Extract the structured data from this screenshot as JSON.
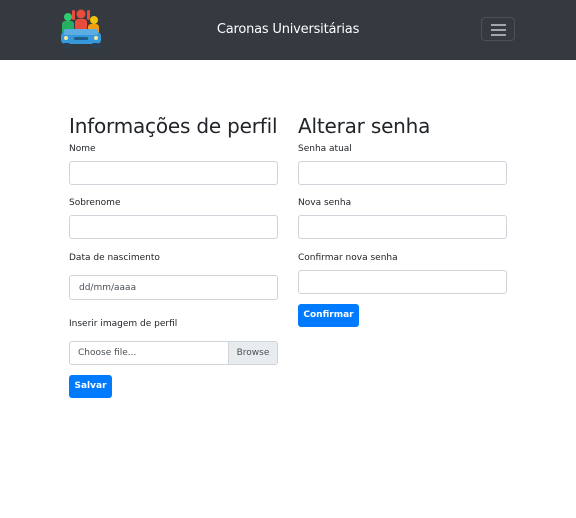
{
  "navbar": {
    "brand": "Caronas Universitárias",
    "logo_icon": "car-people-logo-icon",
    "menu_icon": "hamburger-menu-icon",
    "background": "#343a40"
  },
  "profile": {
    "heading": "Informações de perfil",
    "first_name_label": "Nome",
    "first_name_value": "",
    "last_name_label": "Sobrenome",
    "last_name_value": "",
    "birthdate_label": "Data de nascimento",
    "birthdate_placeholder": "dd/mm/aaaa",
    "image_label": "Inserir imagem de perfil",
    "file_placeholder": "Choose file...",
    "browse_label": "Browse",
    "save_label": "Salvar"
  },
  "password": {
    "heading": "Alterar senha",
    "current_label": "Senha atual",
    "current_value": "",
    "new_label": "Nova senha",
    "new_value": "",
    "confirm_label": "Confirmar nova senha",
    "confirm_value": "",
    "confirm_button_label": "Confirmar"
  },
  "colors": {
    "primary": "#007bff"
  }
}
